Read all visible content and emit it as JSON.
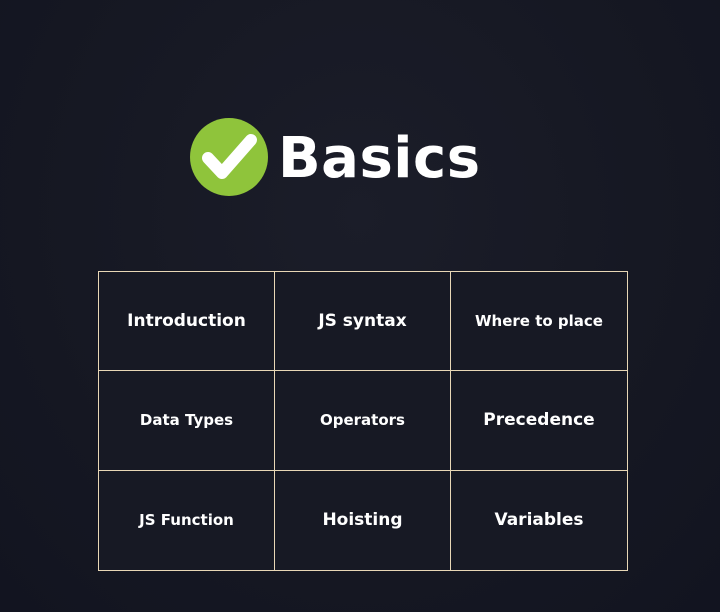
{
  "header": {
    "title": "Basics",
    "icon": "check-circle-icon",
    "accent_color": "#8fc43b"
  },
  "grid": {
    "border_color": "#e8d7b6",
    "items": [
      "Introduction",
      "JS syntax",
      "Where to place",
      "Data Types",
      "Operators",
      "Precedence",
      "JS Function",
      "Hoisting",
      "Variables"
    ]
  }
}
